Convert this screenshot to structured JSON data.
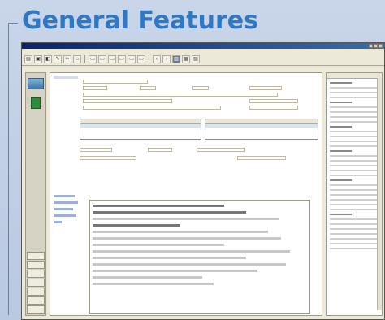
{
  "heading": "General Features",
  "window": {
    "title": "",
    "menu": [
      "",
      "",
      "",
      "",
      "",
      "",
      "",
      ""
    ]
  },
  "sidebar": {
    "header": "",
    "buttons": [
      "",
      "",
      "",
      "",
      "",
      "",
      ""
    ]
  },
  "colors": {
    "heading": "#2f78c4",
    "background": "#c9d6e9",
    "titlebar": "#0a246a",
    "label": "#22489a"
  },
  "icons": [
    "open-folder-icon",
    "print-icon",
    "save-icon",
    "back-arrow-icon",
    "forward-arrow-icon",
    "layout-icon"
  ]
}
